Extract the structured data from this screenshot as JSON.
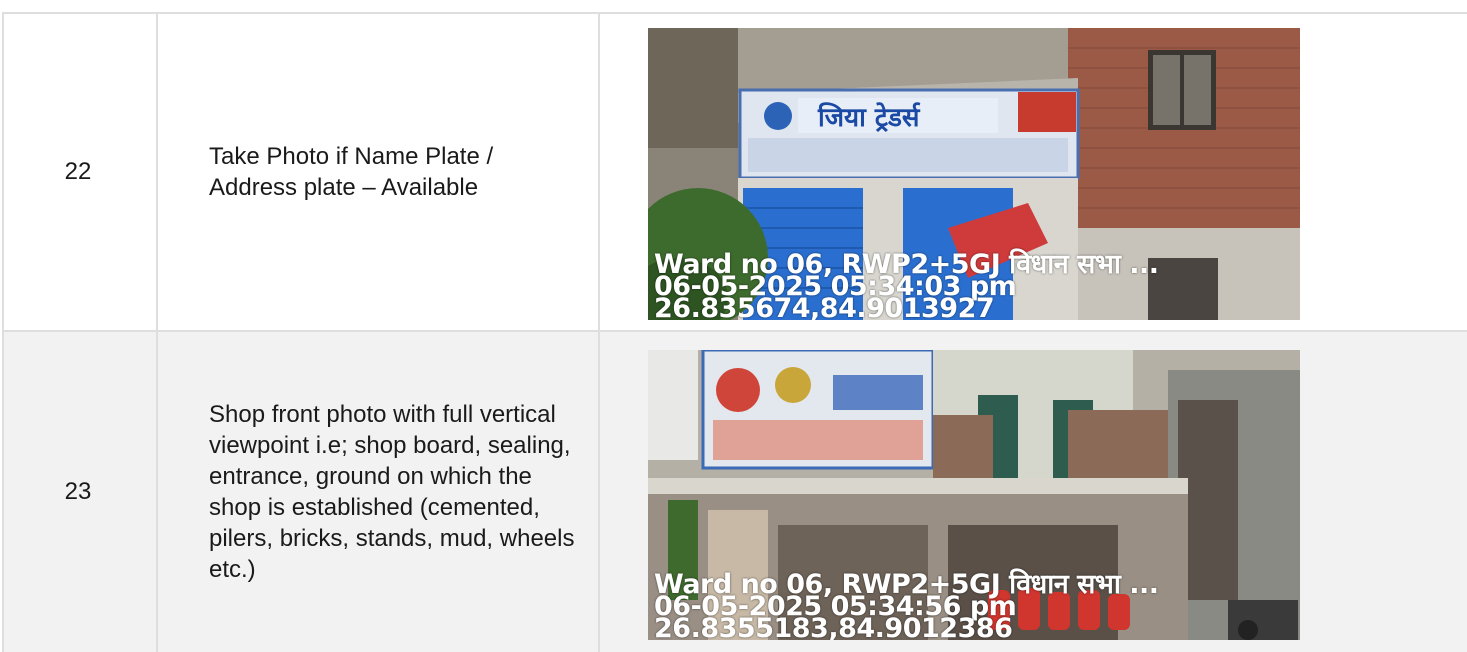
{
  "rows": [
    {
      "number": "22",
      "description": "Take Photo if Name Plate / Address plate – Available",
      "photo": {
        "stamp_line1": "Ward no 06, RWP2+5GJ विधान सभा ...",
        "stamp_line2": "06-05-2025 05:34:03 pm",
        "stamp_line3": "26.835674,84.9013927",
        "sign_text": "जिया ट्रेडर्स"
      }
    },
    {
      "number": "23",
      "description": "Shop front photo with full vertical viewpoint i.e; shop board, sealing, entrance, ground on which the shop is established (cemented, pilers, bricks, stands, mud, wheels etc.)",
      "photo": {
        "stamp_line1": "Ward no 06, RWP2+5GJ विधान सभा ...",
        "stamp_line2": "06-05-2025 05:34:56 pm",
        "stamp_line3": "26.8355183,84.9012386"
      }
    }
  ]
}
